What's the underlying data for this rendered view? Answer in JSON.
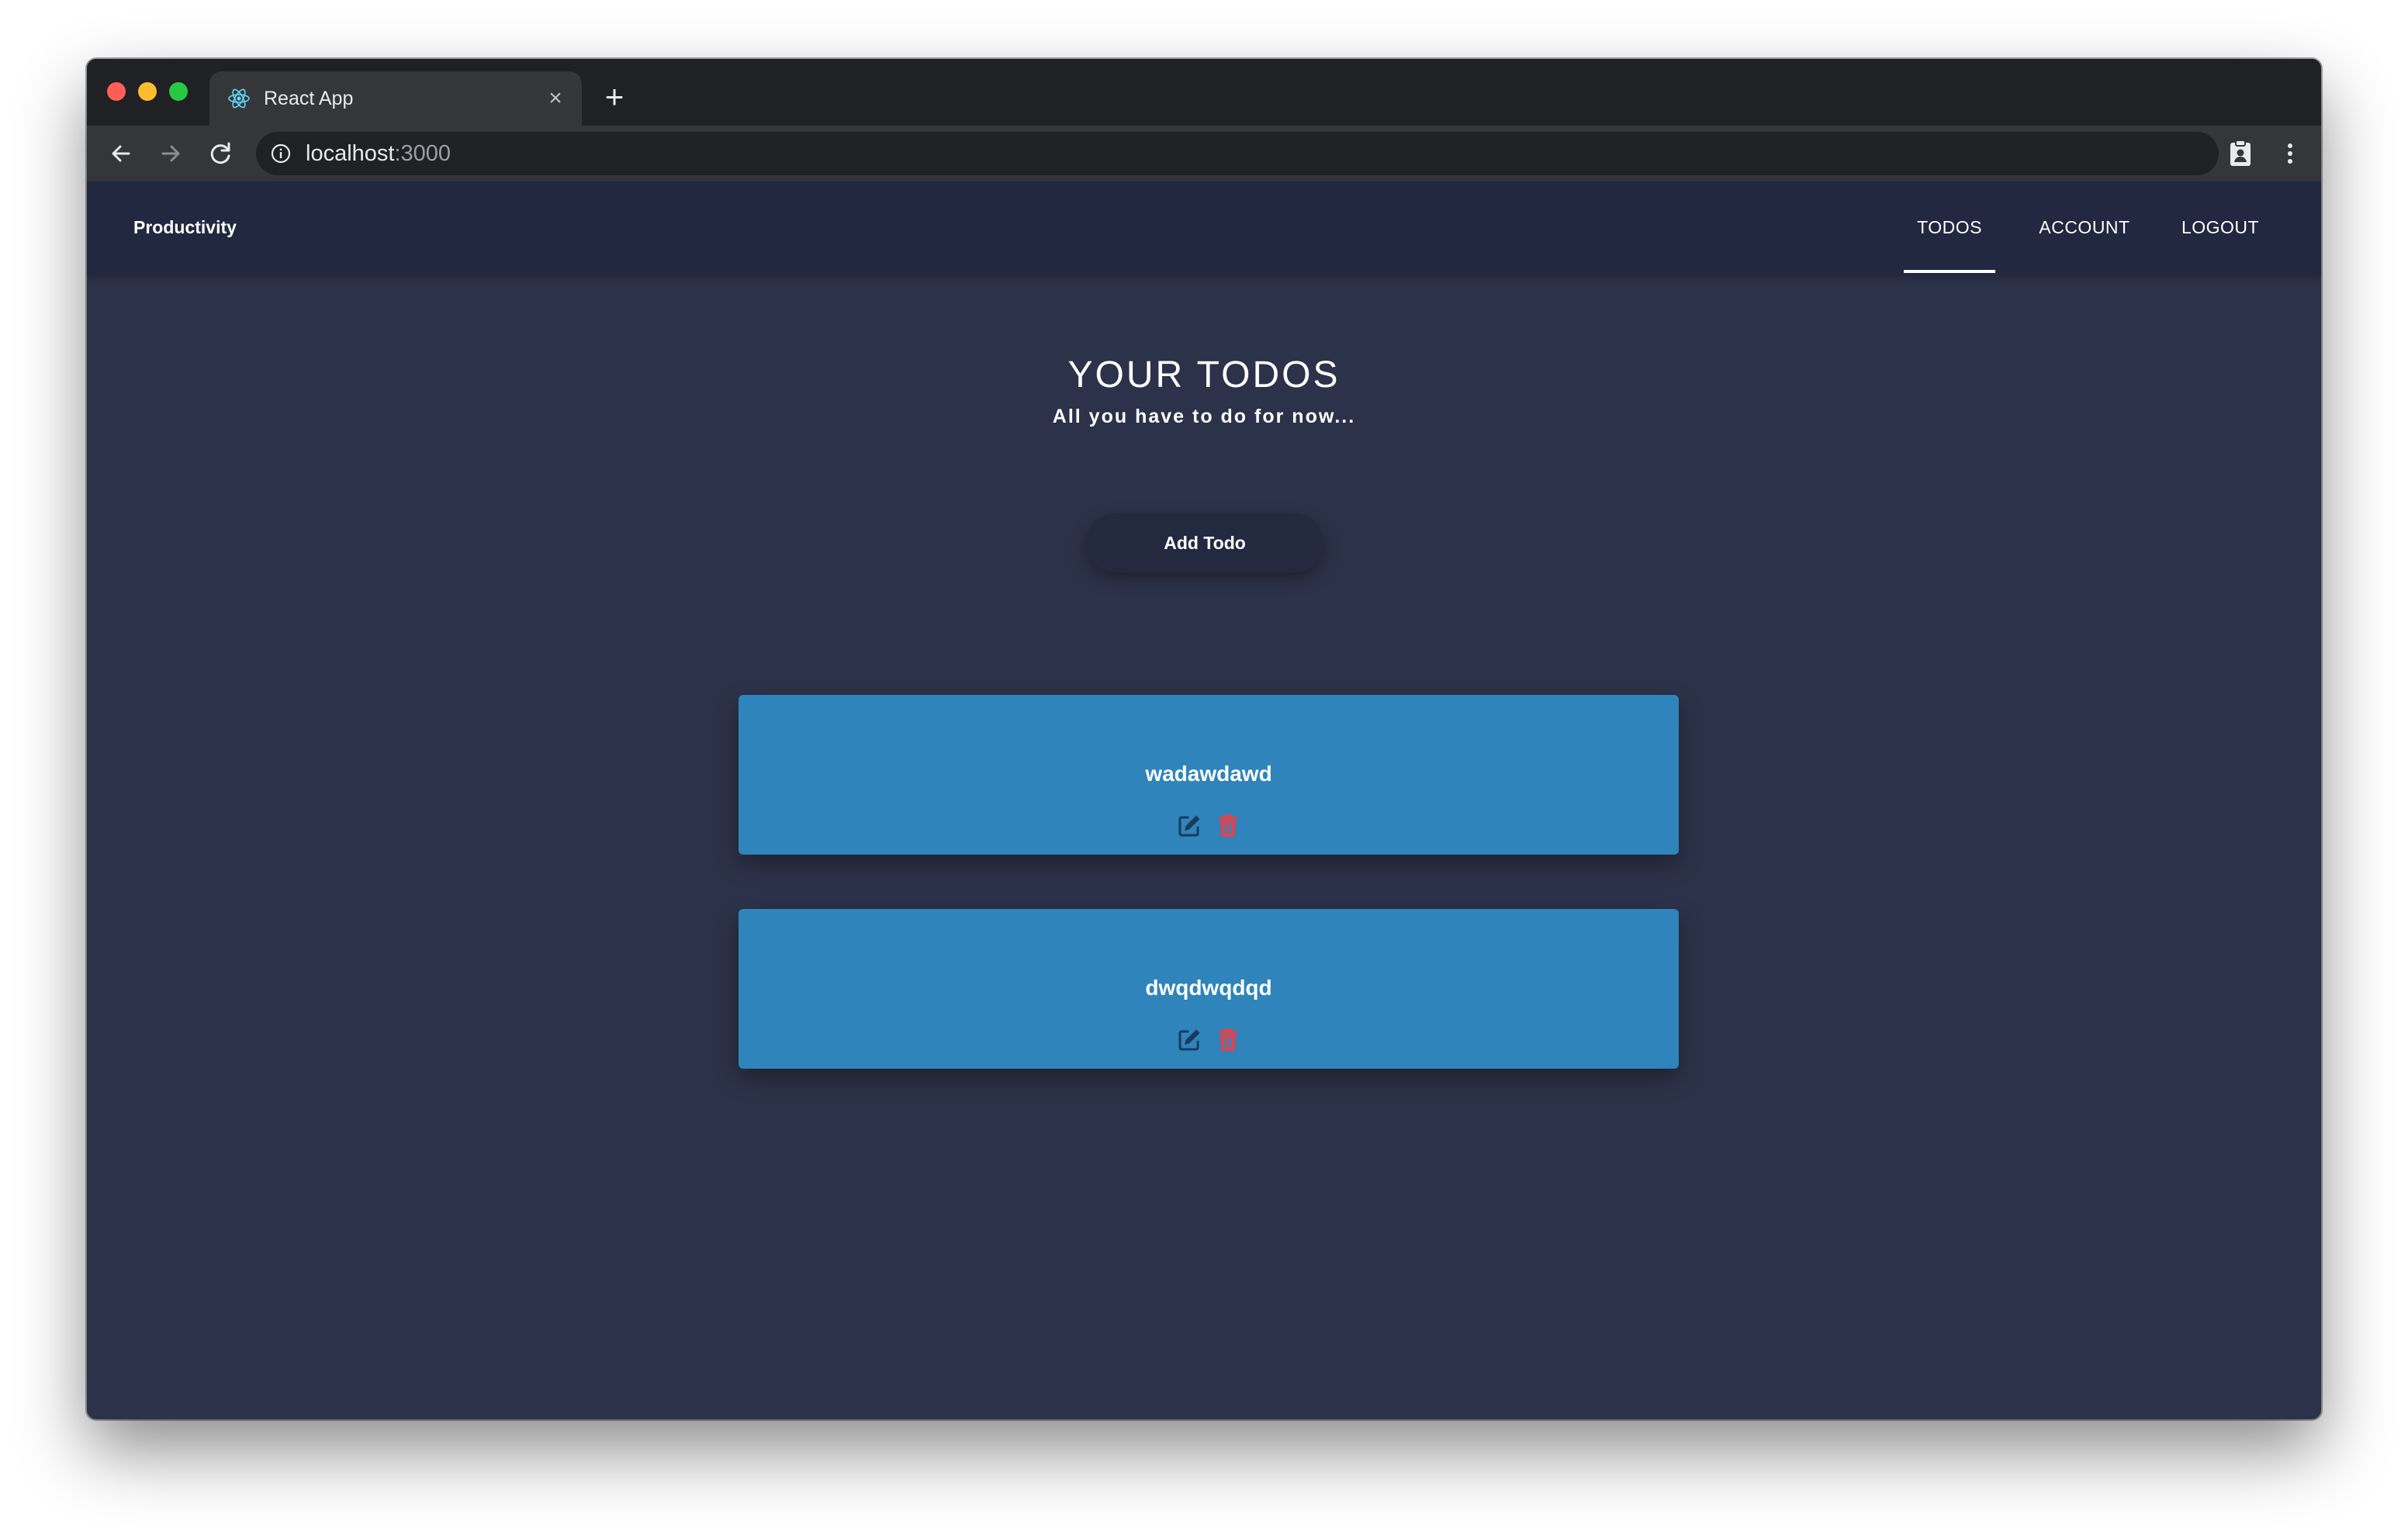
{
  "browser": {
    "tab": {
      "title": "React App",
      "close_glyph": "×",
      "favicon": "react-logo-icon"
    },
    "new_tab_glyph": "+",
    "address": {
      "host": "localhost",
      "port": ":3000"
    },
    "icons": {
      "back": "arrow-left-icon",
      "forward": "arrow-right-icon",
      "reload": "reload-icon",
      "info": "info-icon",
      "extension": "clipboard-badge-icon",
      "menu": "kebab-menu-icon"
    },
    "colors": {
      "tab_strip": "#202124",
      "toolbar": "#35363a"
    }
  },
  "app": {
    "header": {
      "brand": "Productivity",
      "nav": [
        {
          "label": "TODOS",
          "active": true
        },
        {
          "label": "ACCOUNT",
          "active": false
        },
        {
          "label": "LOGOUT",
          "active": false
        }
      ]
    },
    "main": {
      "title": "YOUR TODOS",
      "subtitle": "All you have to do for now...",
      "add_button_label": "Add Todo",
      "todos": [
        {
          "title": "wadawdawd",
          "edit_icon": "edit-icon",
          "delete_icon": "trash-icon"
        },
        {
          "title": "dwqdwqdqd",
          "edit_icon": "edit-icon",
          "delete_icon": "trash-icon"
        }
      ]
    },
    "colors": {
      "background": "#2c3249",
      "header": "#212840",
      "card": "#2e84bb",
      "edit_icon": "#1b3a5c",
      "delete_icon": "#e0434f"
    }
  }
}
